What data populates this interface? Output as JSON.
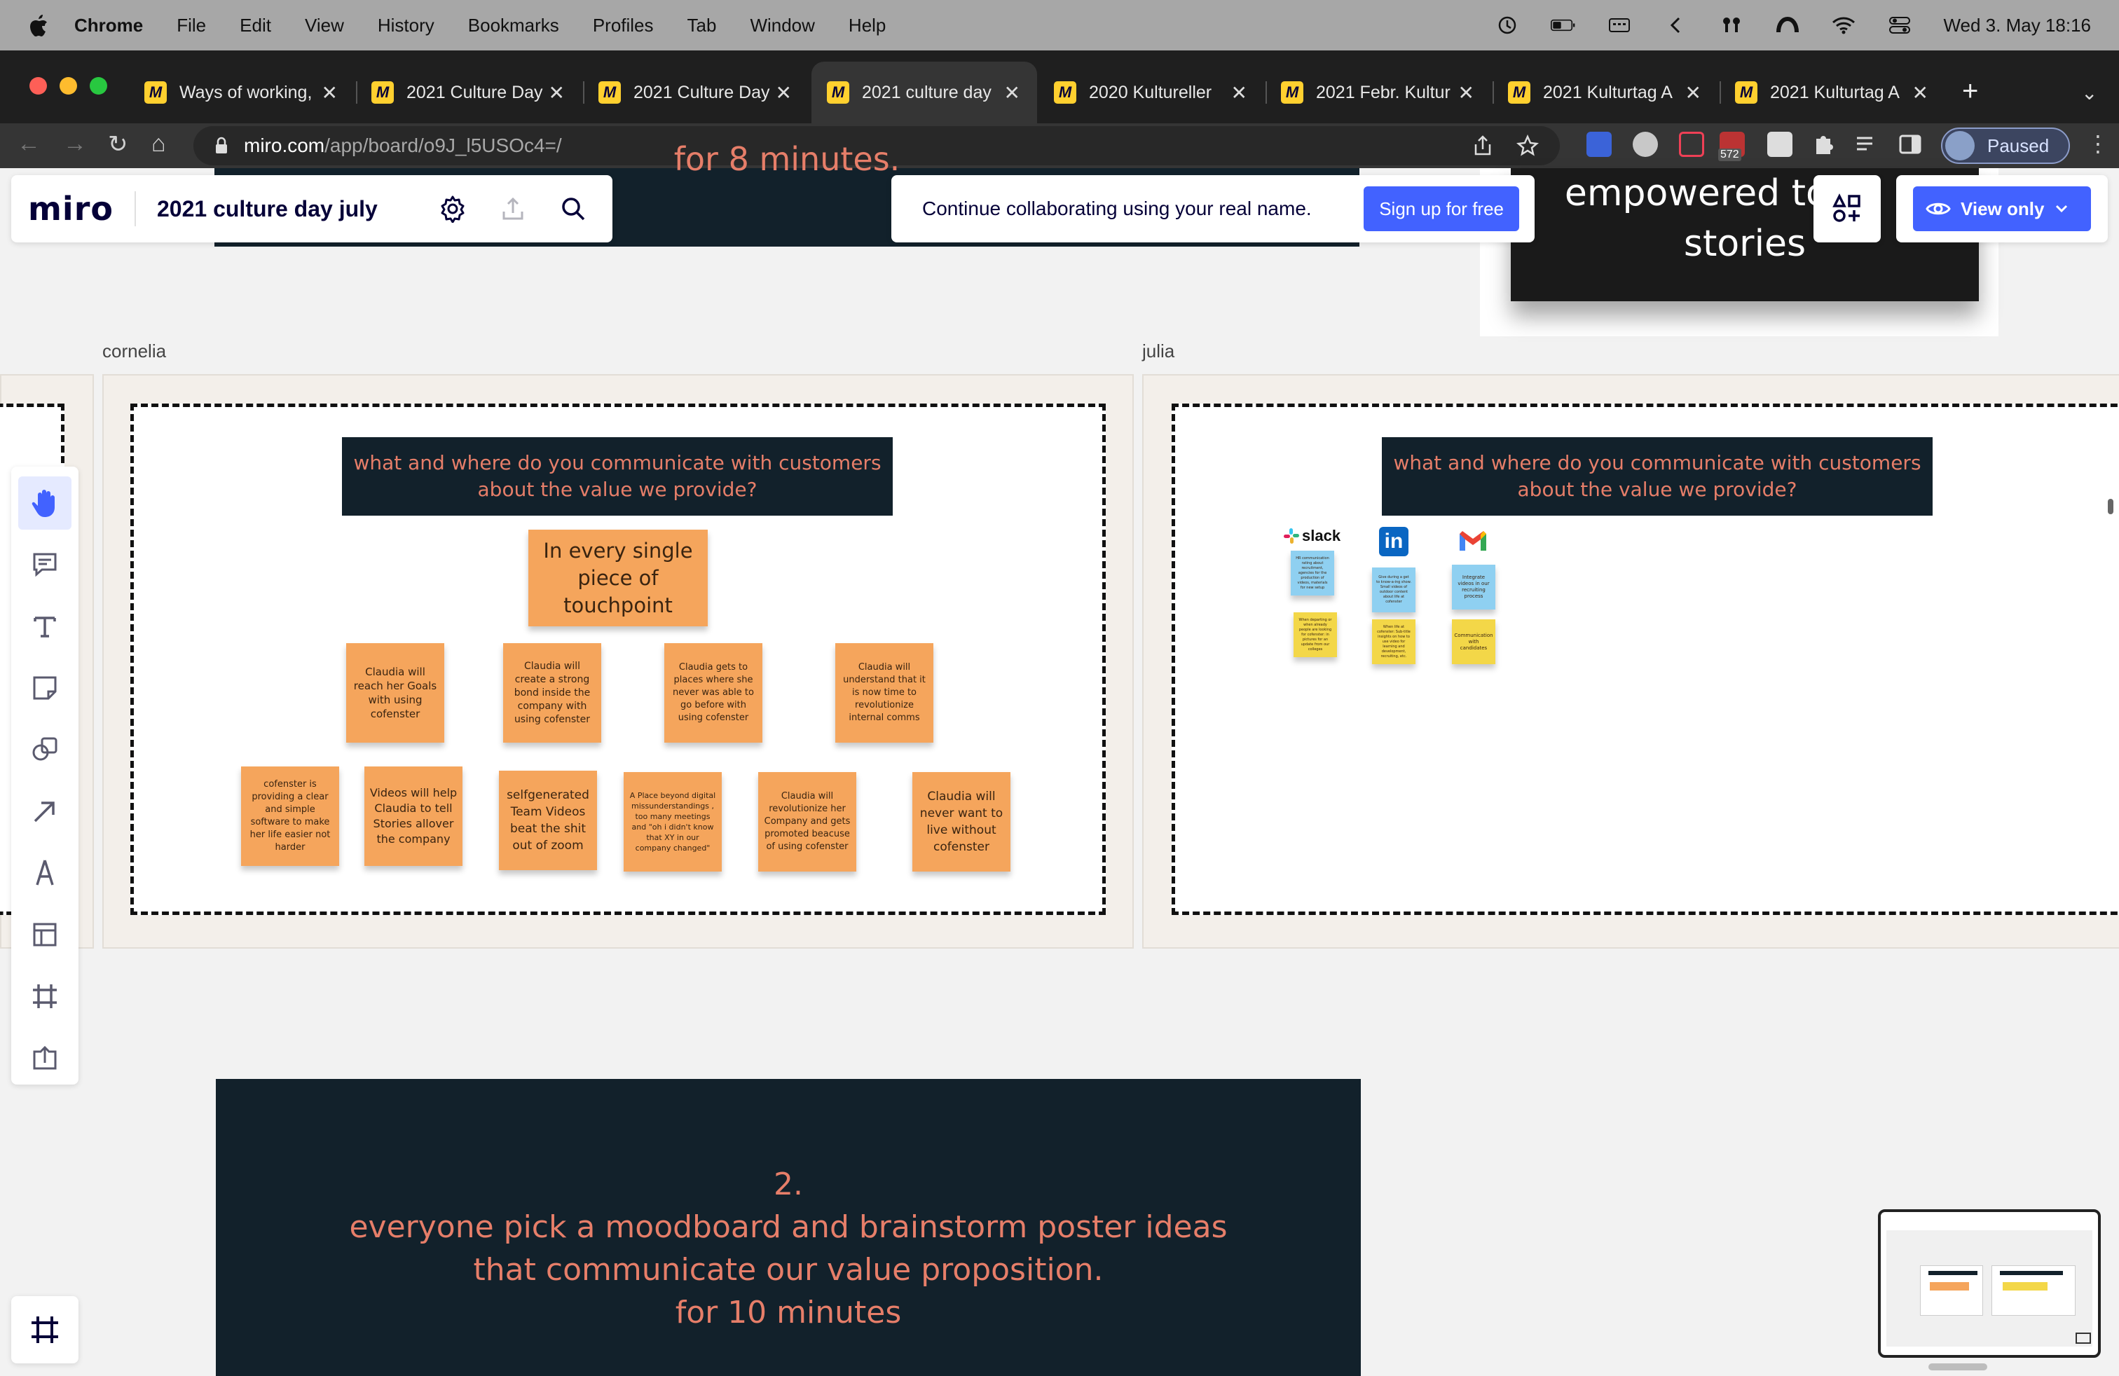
{
  "menubar": {
    "app": "Chrome",
    "items": [
      "File",
      "Edit",
      "View",
      "History",
      "Bookmarks",
      "Profiles",
      "Tab",
      "Window",
      "Help"
    ],
    "clock": "Wed 3. May  18:16"
  },
  "tabs": [
    {
      "title": "Ways of working,"
    },
    {
      "title": "2021 Culture Day"
    },
    {
      "title": "2021 Culture Day"
    },
    {
      "title": "2021 culture day"
    },
    {
      "title": "2020 Kultureller"
    },
    {
      "title": "2021 Febr. Kultur"
    },
    {
      "title": "2021 Kulturtag A"
    },
    {
      "title": "2021 Kulturtag A"
    }
  ],
  "address": {
    "host": "miro.com",
    "path": "/app/board/o9J_l5USOc4=/"
  },
  "extensions": {
    "badge": "572",
    "profile_label": "Paused"
  },
  "miro": {
    "logo": "miro",
    "board_name": "2021 culture day july",
    "collab_message": "Continue collaborating using your real name.",
    "signup_label": "Sign up for free",
    "view_only_label": "View only"
  },
  "canvas": {
    "top_cut_text": "for 8 minutes.",
    "video_text_line1": "empowered to t",
    "video_text_line1_end": "r",
    "video_text_line2": "stories",
    "frames": [
      {
        "label": "cornelia",
        "question": "what and where do you communicate with customers about the value we provide?",
        "main_note": "In every single piece of touchpoint",
        "row1": [
          "Claudia will reach her Goals with using cofenster",
          "Claudia will create a strong bond inside the company with using cofenster",
          "Claudia gets to places where she never was able to go before with using cofenster",
          "Claudia will understand that it is now time to revolutionize internal comms"
        ],
        "row2": [
          "cofenster is providing a clear and simple software to make her life easier not harder",
          "Videos will help Claudia to tell Stories allover the company",
          "selfgenerated Team Videos beat the shit out of zoom",
          "A Place beyond digital missunderstandings , too many meetings and \"oh i didn't know that XY in our company changed\"",
          "Claudia will revolutionize her Company and gets promoted beacuse of using cofenster",
          "Claudia will never want to live without cofenster"
        ]
      },
      {
        "label": "julia",
        "question": "what and where do you communicate with customers about the value we provide?",
        "logos": [
          "slack",
          "in"
        ],
        "notes_blue": [
          "HR communication rating about recruitment, agencies for the production of videos, materials for new setup",
          "Give during a get to know-a-ing show. Small videos of outdoor content about life at cofenster",
          "Integrate videos in our recruiting process"
        ],
        "notes_yellow": [
          "When departing or when already people are looking for cofenster: in pictures for an update from our colleges",
          "When life at cofenster: Sub-title insights on how to use video for learning and development, recruiting, etc.",
          "Communication with candidates"
        ]
      }
    ],
    "step_number": "2.",
    "step_lines": [
      "everyone pick a moodboard and brainstorm poster ideas",
      "that communicate our value proposition.",
      "for 10 minutes"
    ]
  },
  "colors": {
    "accent": "#4262ff",
    "dark_panel": "#12212b",
    "salmon_text": "#e67e69",
    "sticky_orange": "#f5a55c",
    "sticky_blue": "#8fd0f1",
    "sticky_yellow": "#f3d748"
  },
  "icons": [
    "apple-icon",
    "hand-icon",
    "comment-icon",
    "text-icon",
    "sticky-note-icon",
    "shapes-icon",
    "arrow-icon",
    "pen-icon",
    "template-icon",
    "frame-icon",
    "upload-icon",
    "settings-icon",
    "share-icon",
    "search-icon",
    "eye-icon",
    "chevron-down-icon"
  ]
}
